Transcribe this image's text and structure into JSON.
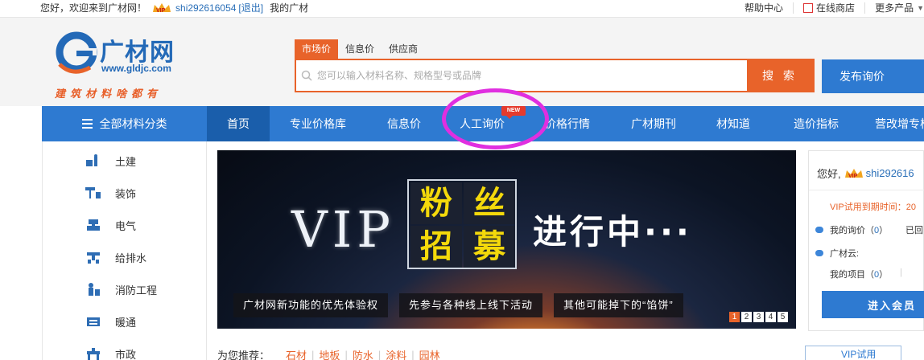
{
  "topbar": {
    "welcome": "您好，欢迎来到广材网！",
    "username": "shi292616054",
    "logout": "[退出]",
    "my_gc": "我的广材",
    "help": "帮助中心",
    "store": "在线商店",
    "more": "更多产品"
  },
  "logo": {
    "name": "广材网",
    "url": "www.gldjc.com",
    "slogan": "建筑材料啥都有"
  },
  "search": {
    "tabs": [
      "市场价",
      "信息价",
      "供应商"
    ],
    "placeholder": "您可以输入材料名称、规格型号或品牌",
    "button": "搜 索",
    "publish": "发布询价"
  },
  "nav": {
    "all_categories": "全部材料分类",
    "items": [
      "首页",
      "专业价格库",
      "信息价",
      "人工询价",
      "价格行情",
      "广材期刊",
      "材知道",
      "造价指标",
      "营改增专栏"
    ],
    "new_badge": "NEW"
  },
  "categories": [
    "土建",
    "装饰",
    "电气",
    "给排水",
    "消防工程",
    "暖通",
    "市政"
  ],
  "banner": {
    "vip": "VIP",
    "chars": [
      "粉",
      "丝",
      "招",
      "募"
    ],
    "headline": "进行中···",
    "captions": [
      "广材网新功能的优先体验权",
      "先参与各种线上线下活动",
      "其他可能掉下的“馅饼”"
    ],
    "dots": [
      "1",
      "2",
      "3",
      "4",
      "5"
    ],
    "active_dot": "1"
  },
  "recommend": {
    "title": "为您推荐：",
    "tags": [
      "石材",
      "地板",
      "防水",
      "涂料",
      "园林"
    ]
  },
  "right_panel": {
    "hello": "您好,",
    "username": "shi292616",
    "expire": "VIP试用到期时间：20",
    "my_inquiry": "我的询价（",
    "my_inquiry_count": "0",
    "my_inquiry_tail": "）",
    "replied": "已回",
    "cloud": "广材云:",
    "my_projects": "我的项目（",
    "my_projects_count": "0",
    "my_projects_tail": "）",
    "join_button": "进入会员",
    "trial_button": "VIP试用"
  },
  "colors": {
    "brand_blue": "#2e7ad1",
    "accent_orange": "#e8632a",
    "highlight_circle": "#e02fe0"
  }
}
